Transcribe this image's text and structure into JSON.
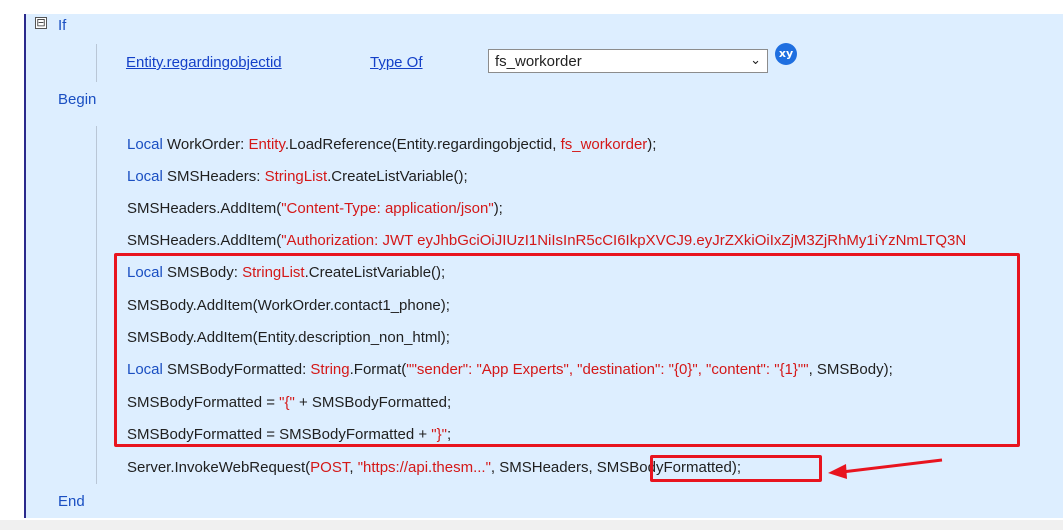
{
  "block": {
    "if_label": "If",
    "begin_label": "Begin",
    "end_label": "End",
    "collapse_glyph": "⊟"
  },
  "condition": {
    "field": "Entity.regardingobjectid",
    "operator": "Type Of",
    "entity_value": "fs_workorder",
    "dropdown_chevron": "⌄",
    "variable_badge": "xy"
  },
  "lines": [
    {
      "kw": "Local",
      "pre": " WorkOrder: ",
      "typ": "Entity",
      "body": ".LoadReference(Entity.regardingobjectid, ",
      "str": "fs_workorder",
      "post": ");"
    },
    {
      "kw": "Local",
      "pre": " SMSHeaders: ",
      "typ": "StringList",
      "body": ".CreateListVariable();",
      "str": "",
      "post": ""
    },
    {
      "kw": "",
      "pre": "",
      "typ": "",
      "body": "SMSHeaders.AddItem(",
      "str": "\"Content-Type: application/json\"",
      "post": ");"
    },
    {
      "kw": "",
      "pre": "",
      "typ": "",
      "body": "SMSHeaders.AddItem(",
      "str": "\"Authorization: JWT eyJhbGciOiJIUzI1NiIsInR5cCI6IkpXVCJ9.eyJrZXkiOiIxZjM3ZjRhMy1iYzNmLTQ3N",
      "post": ""
    },
    {
      "kw": "Local",
      "pre": " SMSBody: ",
      "typ": "StringList",
      "body": ".CreateListVariable();",
      "str": "",
      "post": ""
    },
    {
      "kw": "",
      "pre": "",
      "typ": "",
      "body": "SMSBody.AddItem(WorkOrder.contact1_phone);",
      "str": "",
      "post": ""
    },
    {
      "kw": "",
      "pre": "",
      "typ": "",
      "body": "SMSBody.AddItem(Entity.description_non_html);",
      "str": "",
      "post": ""
    },
    {
      "kw": "Local",
      "pre": " SMSBodyFormatted: ",
      "typ": "String",
      "body": ".Format(",
      "str": "\"\"sender\": \"App Experts\", \"destination\": \"{0}\", \"content\": \"{1}\"\"",
      "post": ", SMSBody);"
    },
    {
      "kw": "",
      "pre": "",
      "typ": "",
      "body": "SMSBodyFormatted = ",
      "str": "\"{\"",
      "post": " + SMSBodyFormatted;"
    },
    {
      "kw": "",
      "pre": "",
      "typ": "",
      "body": "SMSBodyFormatted = SMSBodyFormatted + ",
      "str": "\"}\"",
      "post": ";"
    }
  ],
  "invoke_line": {
    "prefix": "Server.InvokeWebRequest(",
    "method": "POST",
    "sep1": ", ",
    "url": "\"https://api.thesm...\"",
    "mid": ", SMSHeaders, ",
    "body_arg": "SMSBodyFormatted",
    "suffix": ");"
  },
  "colors": {
    "keyword": "#1a4fc2",
    "string": "#d41818",
    "highlight": "#e8141f",
    "panel_bg": "#ddeeff"
  }
}
